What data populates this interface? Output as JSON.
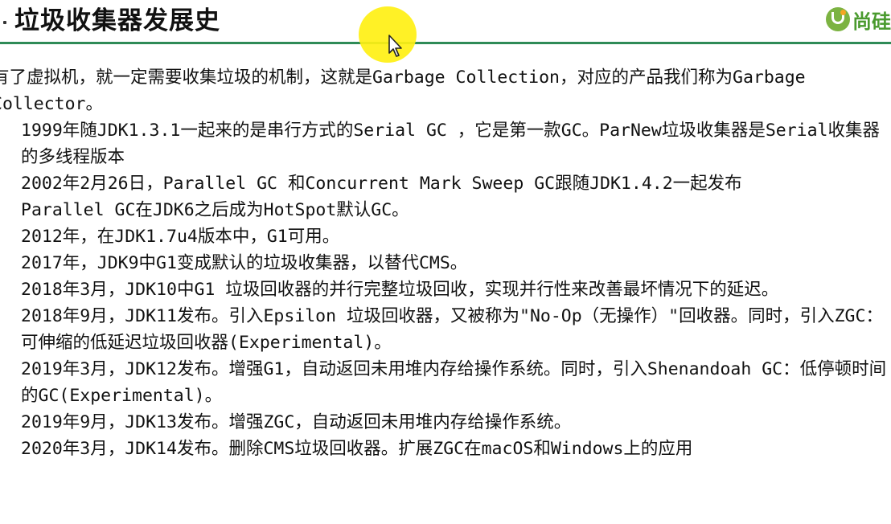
{
  "header": {
    "title": "垃圾收集器发展史",
    "logo_text": "尚硅",
    "accent_color": "#2e8b57",
    "logo_color": "#7cb342"
  },
  "body": {
    "intro": "有了虚拟机，就一定需要收集垃圾的机制，这就是Garbage Collection，对应的产品我们称为Garbage Collector。",
    "items": [
      "1999年随JDK1.3.1一起来的是串行方式的Serial GC ，它是第一款GC。ParNew垃圾收集器是Serial收集器的多线程版本",
      "2002年2月26日，Parallel GC 和Concurrent Mark Sweep GC跟随JDK1.4.2一起发布",
      "Parallel GC在JDK6之后成为HotSpot默认GC。",
      "2012年，在JDK1.7u4版本中，G1可用。",
      "2017年，JDK9中G1变成默认的垃圾收集器，以替代CMS。",
      "2018年3月，JDK10中G1 垃圾回收器的并行完整垃圾回收，实现并行性来改善最坏情况下的延迟。",
      "2018年9月，JDK11发布。引入Epsilon 垃圾回收器，又被称为\"No-Op（无操作）\"回收器。同时，引入ZGC：可伸缩的低延迟垃圾回收器(Experimental)。",
      "2019年3月，JDK12发布。增强G1，自动返回未用堆内存给操作系统。同时，引入Shenandoah GC：低停顿时间的GC(Experimental)。",
      "2019年9月，JDK13发布。增强ZGC，自动返回未用堆内存给操作系统。",
      "2020年3月，JDK14发布。删除CMS垃圾回收器。扩展ZGC在macOS和Windows上的应用"
    ]
  },
  "overlay": {
    "cursor_icon": "arrow-cursor-icon",
    "highlight_color": "#fff014"
  }
}
